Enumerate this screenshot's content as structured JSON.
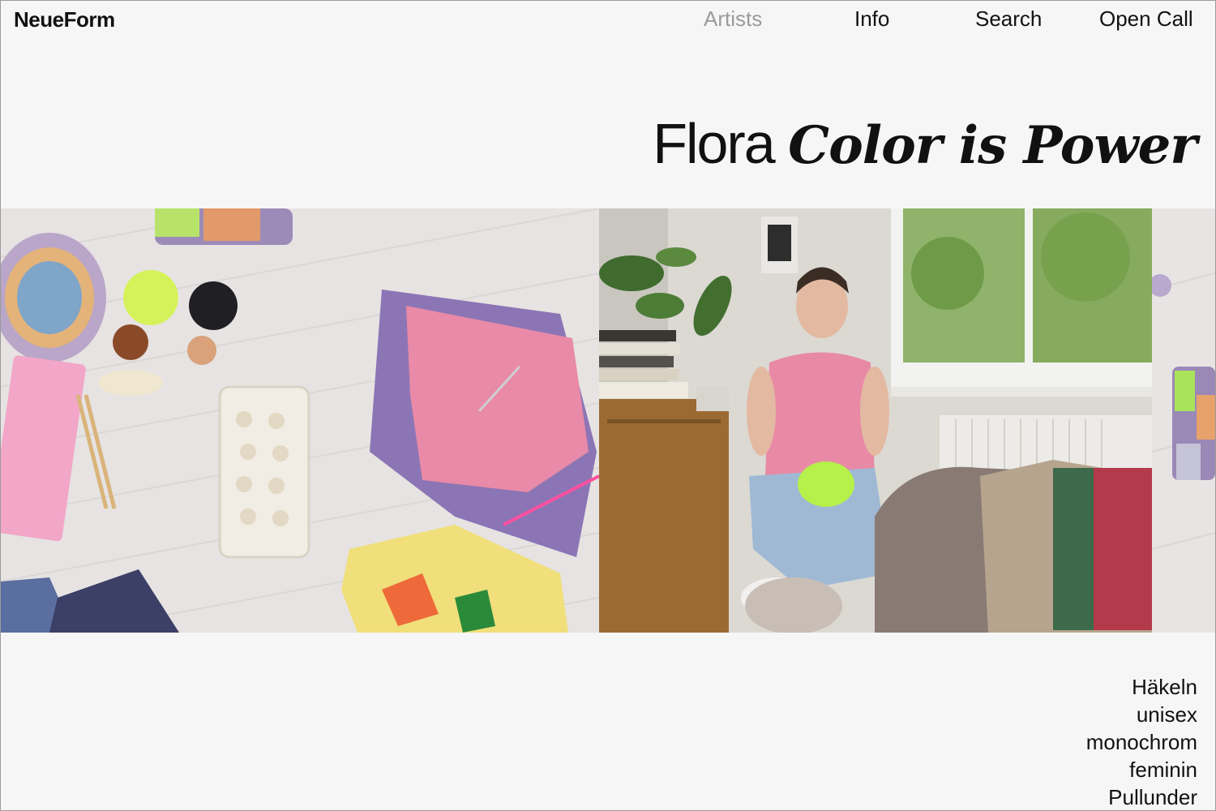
{
  "site": {
    "logo": "NeueForm"
  },
  "nav": {
    "items": [
      {
        "label": "Artists",
        "active": true
      },
      {
        "label": "Info",
        "active": false
      },
      {
        "label": "Search",
        "active": false
      },
      {
        "label": "Open Call",
        "active": false
      }
    ]
  },
  "artist": {
    "name": "Flora",
    "work_title": "Color is Power"
  },
  "tags": [
    "Häkeln",
    "unisex",
    "monochrom",
    "feminin",
    "Pullunder"
  ],
  "colors": {
    "background": "#f6f6f6",
    "text": "#111111",
    "nav_active": "#9b9b9b"
  }
}
